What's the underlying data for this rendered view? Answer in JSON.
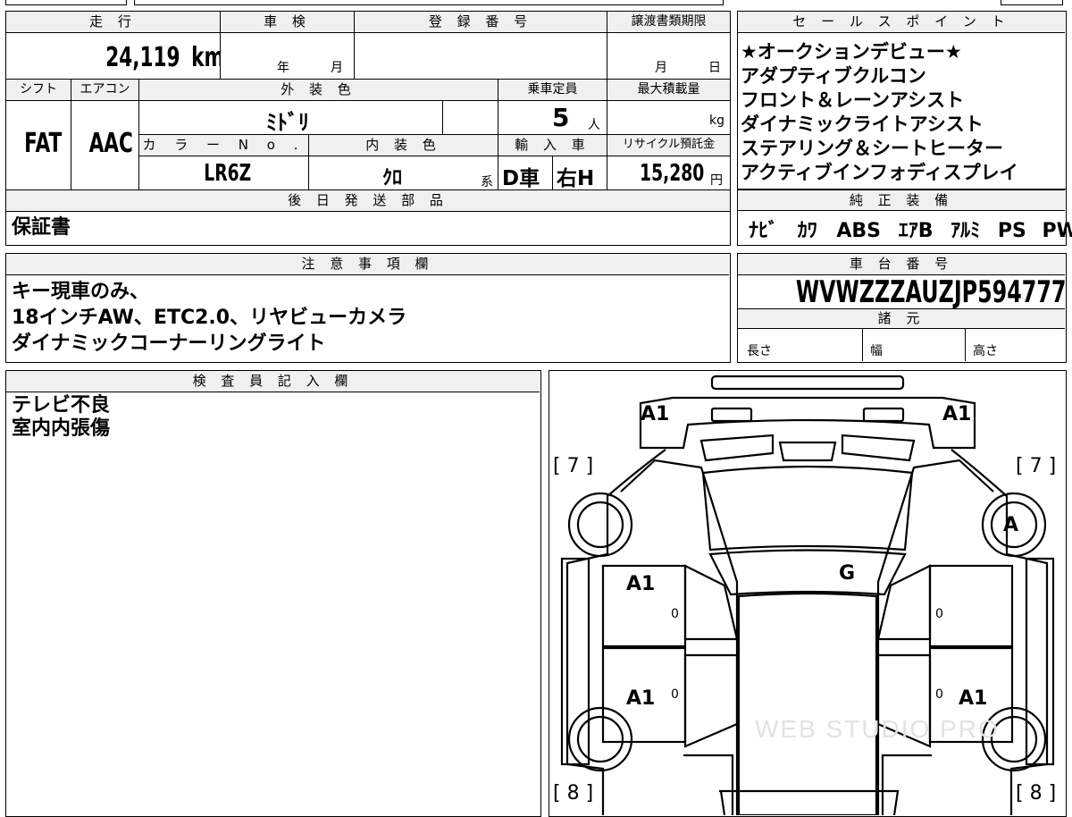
{
  "header_table": {
    "labels": {
      "mileage": "走 行",
      "inspection": "車 検",
      "registration": "登 録 番 号",
      "transfer_deadline": "譲渡書類期限",
      "shift": "シフト",
      "aircon": "エアコン",
      "exterior_color": "外 装 色",
      "capacity": "乗車定員",
      "max_load": "最大積載量",
      "color_no": "カ ラ ー N o .",
      "interior_color": "内 装 色",
      "import": "輸 入 車",
      "recycle_fee": "リサイクル預託金",
      "later_parts": "後 日 発 送 部 品"
    },
    "values": {
      "mileage": "24,119",
      "mileage_unit": "km",
      "inspection_year": "年",
      "inspection_month": "月",
      "deadline_month": "月",
      "deadline_day": "日",
      "shift": "FAT",
      "aircon": "AAC",
      "exterior_color": "ﾐﾄﾞﾘ",
      "capacity": "5",
      "capacity_unit": "人",
      "load_unit": "kg",
      "color_no": "LR6Z",
      "interior_color": "ｸﾛ",
      "interior_suffix": "系",
      "import_type": "D車",
      "steering": "右H",
      "recycle_fee": "15,280",
      "recycle_unit": "円",
      "later_parts": "保証書"
    }
  },
  "sales_points": {
    "header": "セ ー ル ス ポ イ ン ト",
    "lines": [
      "★オークションデビュー★",
      "アダプティブクルコン",
      "フロント＆レーンアシスト",
      "ダイナミックライトアシスト",
      "ステアリング＆シートヒーター",
      "アクティブインフォディスプレイ"
    ]
  },
  "equipment": {
    "header": "純 正 装 備",
    "items": [
      "ﾅﾋﾞ",
      "ｶﾜ",
      "ABS",
      "ｴｱB",
      "ｱﾙﾐ",
      "PS",
      "PW"
    ]
  },
  "notes": {
    "header": "注 意 事 項 欄",
    "lines": [
      "キー現車のみ、",
      "18インチAW、ETC2.0、リヤビューカメラ",
      "ダイナミックコーナーリングライト"
    ]
  },
  "chassis": {
    "header": "車 台 番 号",
    "number": "WVWZZZAUZJP594777"
  },
  "specs": {
    "header": "諸 元",
    "length": "長さ",
    "width": "幅",
    "height": "高さ"
  },
  "inspector": {
    "header": "検 査 員 記 入 欄",
    "lines": [
      "テレビ不良",
      "室内内張傷"
    ]
  },
  "diagram": {
    "marks": {
      "front_left": "A1",
      "front_right": "A1",
      "front_fender_left_bracket": "[ 7 ]",
      "front_fender_right_bracket": "[ 7 ]",
      "front_right_wheel": "A",
      "roof": "G",
      "front_door_left": "A1",
      "rear_door_left": "A1",
      "rear_door_right": "A1",
      "rear_fender_left_bracket": "[ 8 ]",
      "rear_fender_right_bracket": "[ 8 ]",
      "door_zero": "0"
    },
    "watermark": "WEB STUDIO PRO"
  }
}
